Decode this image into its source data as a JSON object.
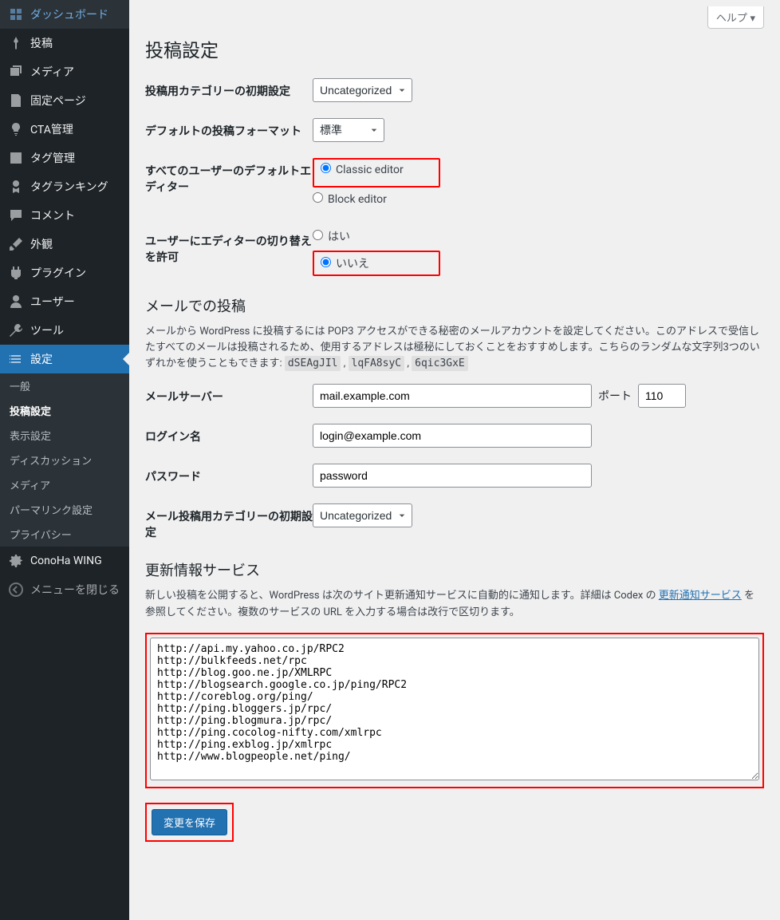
{
  "help_label": "ヘルプ ▾",
  "page_title": "投稿設定",
  "sidebar": {
    "items": [
      {
        "label": "ダッシュボード",
        "icon": "dashboard"
      },
      {
        "label": "投稿",
        "icon": "pin"
      },
      {
        "label": "メディア",
        "icon": "media"
      },
      {
        "label": "固定ページ",
        "icon": "page"
      },
      {
        "label": "CTA管理",
        "icon": "bulb"
      },
      {
        "label": "タグ管理",
        "icon": "tag"
      },
      {
        "label": "タグランキング",
        "icon": "award"
      },
      {
        "label": "コメント",
        "icon": "comment"
      },
      {
        "label": "外観",
        "icon": "brush"
      },
      {
        "label": "プラグイン",
        "icon": "plugin"
      },
      {
        "label": "ユーザー",
        "icon": "user"
      },
      {
        "label": "ツール",
        "icon": "tool"
      },
      {
        "label": "設定",
        "icon": "settings",
        "active": true
      },
      {
        "label": "ConoHa WING",
        "icon": "gear"
      },
      {
        "label": "メニューを閉じる",
        "icon": "collapse"
      }
    ],
    "sub": [
      {
        "label": "一般"
      },
      {
        "label": "投稿設定",
        "current": true
      },
      {
        "label": "表示設定"
      },
      {
        "label": "ディスカッション"
      },
      {
        "label": "メディア"
      },
      {
        "label": "パーマリンク設定"
      },
      {
        "label": "プライバシー"
      }
    ]
  },
  "fields": {
    "default_category": {
      "label": "投稿用カテゴリーの初期設定",
      "value": "Uncategorized"
    },
    "default_format": {
      "label": "デフォルトの投稿フォーマット",
      "value": "標準"
    },
    "default_editor": {
      "label": "すべてのユーザーのデフォルトエディター",
      "options": {
        "classic": "Classic editor",
        "block": "Block editor"
      }
    },
    "allow_switch": {
      "label": "ユーザーにエディターの切り替えを許可",
      "options": {
        "yes": "はい",
        "no": "いいえ"
      }
    }
  },
  "mail_section": {
    "title": "メールでの投稿",
    "desc_pre": "メールから WordPress に投稿するには POP3 アクセスができる秘密のメールアカウントを設定してください。このアドレスで受信したすべてのメールは投稿されるため、使用するアドレスは極秘にしておくことをおすすめします。こちらのランダムな文字列3つのいずれかを使うこともできます: ",
    "random1": "dSEAgJIl",
    "random2": "lqFA8syC",
    "random3": "6qic3GxE",
    "server": {
      "label": "メールサーバー",
      "value": "mail.example.com",
      "port_label": "ポート",
      "port_value": "110"
    },
    "login": {
      "label": "ログイン名",
      "value": "login@example.com"
    },
    "password": {
      "label": "パスワード",
      "value": "password"
    },
    "category": {
      "label": "メール投稿用カテゴリーの初期設定",
      "value": "Uncategorized"
    }
  },
  "update_section": {
    "title": "更新情報サービス",
    "desc_pre": "新しい投稿を公開すると、WordPress は次のサイト更新通知サービスに自動的に通知します。詳細は Codex の ",
    "desc_link": "更新通知サービス",
    "desc_post": " を参照してください。複数のサービスの URL を入力する場合は改行で区切ります。",
    "urls": "http://api.my.yahoo.co.jp/RPC2\nhttp://bulkfeeds.net/rpc\nhttp://blog.goo.ne.jp/XMLRPC\nhttp://blogsearch.google.co.jp/ping/RPC2\nhttp://coreblog.org/ping/\nhttp://ping.bloggers.jp/rpc/\nhttp://ping.blogmura.jp/rpc/\nhttp://ping.cocolog-nifty.com/xmlrpc\nhttp://ping.exblog.jp/xmlrpc\nhttp://www.blogpeople.net/ping/"
  },
  "submit_label": "変更を保存"
}
